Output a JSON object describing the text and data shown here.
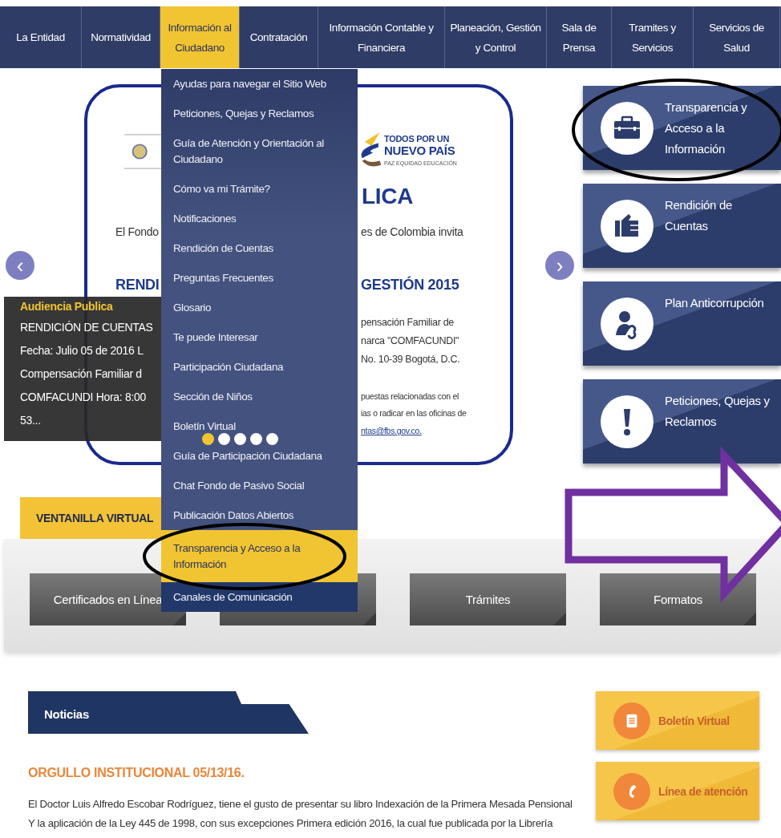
{
  "nav": {
    "tabs": [
      {
        "label": "La Entidad",
        "selected": false
      },
      {
        "label": "Normatividad",
        "selected": false
      },
      {
        "label": "Información al Ciudadano",
        "selected": true
      },
      {
        "label": "Contratación",
        "selected": false
      },
      {
        "label": "Información Contable y Financiera",
        "selected": false
      },
      {
        "label": "Planeación, Gestión y Control",
        "selected": false
      },
      {
        "label": "Sala de Prensa",
        "selected": false
      },
      {
        "label": "Tramites y Servicios",
        "selected": false
      },
      {
        "label": "Servicios de Salud",
        "selected": false
      }
    ]
  },
  "dropdown": {
    "items": [
      {
        "label": "Ayudas para navegar el Sitio Web",
        "selected": false
      },
      {
        "label": "Peticiones, Quejas y Reclamos",
        "selected": false
      },
      {
        "label": "Guía de Atención y Orientación al Ciudadano",
        "selected": false
      },
      {
        "label": "Cómo va mi Trámite?",
        "selected": false
      },
      {
        "label": "Notificaciones",
        "selected": false
      },
      {
        "label": "Rendición de Cuentas",
        "selected": false
      },
      {
        "label": "Preguntas Frecuentes",
        "selected": false
      },
      {
        "label": "Glosario",
        "selected": false
      },
      {
        "label": "Te puede Interesar",
        "selected": false
      },
      {
        "label": "Participación Ciudadana",
        "selected": false
      },
      {
        "label": "Sección de Niños",
        "selected": false
      },
      {
        "label": "Boletín Virtual",
        "selected": false
      },
      {
        "label": "Guía de Participación Ciudadana",
        "selected": false
      },
      {
        "label": "Chat Fondo de Pasivo Social",
        "selected": false
      },
      {
        "label": "Publicación Datos Abiertos",
        "selected": false
      },
      {
        "label": "Transparencia y Acceso a la Información",
        "selected": true
      },
      {
        "label": "Canales de Comunicación",
        "selected": false
      }
    ]
  },
  "slider": {
    "prev": "‹",
    "next": "›",
    "banner": [
      {
        "kind": "logo-small",
        "text": "TODOS POR UN"
      },
      {
        "kind": "logo-big",
        "text": "NUEVO PAÍS"
      },
      {
        "kind": "logo-tiny",
        "text": "PAZ EQUIDAD EDUCACIÓN"
      },
      {
        "kind": "title",
        "text": "LICA"
      },
      {
        "kind": "body",
        "text": "El Fondo"
      },
      {
        "kind": "body",
        "text": "es de Colombia invita"
      },
      {
        "kind": "heading",
        "text": "RENDI"
      },
      {
        "kind": "heading",
        "text": "GESTIÓN 2015"
      },
      {
        "kind": "detail",
        "text": "pensación Familiar de"
      },
      {
        "kind": "detail",
        "text": "narca \"COMFACUNDI\""
      },
      {
        "kind": "detail",
        "text": "No. 10-39 Bogotá, D.C."
      },
      {
        "kind": "small",
        "text": "puestas relacionadas con el"
      },
      {
        "kind": "small",
        "text": "ias o radicar en las oficinas de"
      },
      {
        "kind": "link",
        "text": "ntas@fbs.gov.co."
      }
    ],
    "caption": {
      "title": "Audiencia Publica",
      "lines": [
        "RENDICIÓN DE CUENTAS",
        "Fecha: Julio 05 de 2016 L",
        "Compensación Familiar d",
        "COMFACUNDI Hora: 8:00",
        "53..."
      ]
    },
    "dots": [
      {
        "selected": true
      },
      {
        "selected": false
      },
      {
        "selected": false
      },
      {
        "selected": false
      },
      {
        "selected": false
      }
    ]
  },
  "side_links": [
    {
      "kind": "briefcase",
      "label": "Transparencia y Acceso a la Información"
    },
    {
      "kind": "fist",
      "label": "Rendición de Cuentas"
    },
    {
      "kind": "person-link",
      "label": "Plan Anticorrupción"
    },
    {
      "kind": "exclamation",
      "label": "Peticiones, Quejas y Reclamos"
    }
  ],
  "ventanilla": {
    "title": "VENTANILLA VIRTUAL",
    "buttons": [
      {
        "kind": "labeled",
        "label": "Certificados en Línea"
      },
      {
        "kind": "covered"
      },
      {
        "kind": "labeled",
        "label": "Trámites"
      },
      {
        "kind": "labeled",
        "label": "Formatos"
      }
    ]
  },
  "news": {
    "heading": "Noticias",
    "title": "ORGULLO INSTITUCIONAL 05/13/16.",
    "text": "El Doctor Luis Alfredo Escobar Rodríguez, tiene el gusto de presentar su libro Indexación de la Primera Mesada Pensional Y la aplicación de la Ley 445 de 1998, con sus excepciones Primera edición 2016, la cual fue publicada por la Librería"
  },
  "quick_links": [
    {
      "kind": "document",
      "label": "Boletín Virtual"
    },
    {
      "kind": "phone",
      "label": "Línea de atención"
    }
  ]
}
